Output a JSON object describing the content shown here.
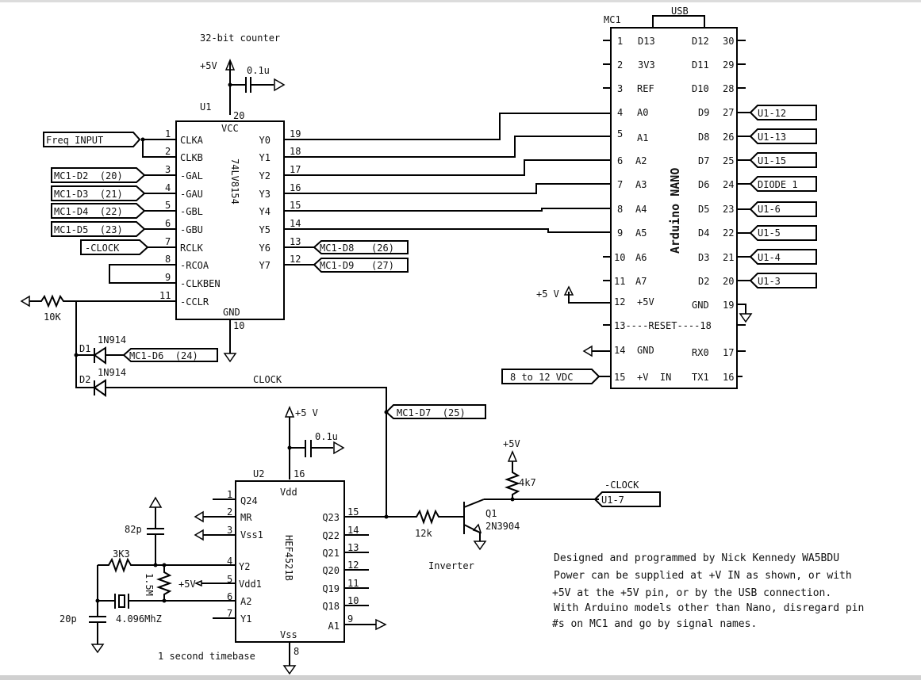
{
  "title": "32-bit counter",
  "u1": {
    "ref": "U1",
    "part": "74LV8154",
    "vcc_label": "VCC",
    "gnd_label": "GND",
    "vcc_pin": "20",
    "gnd_pin": "10",
    "supply": "+5V",
    "cap": "0.1u",
    "left_pins": [
      {
        "num": "1",
        "name": "CLKA"
      },
      {
        "num": "2",
        "name": "CLKB"
      },
      {
        "num": "3",
        "name": "-GAL"
      },
      {
        "num": "4",
        "name": "-GAU"
      },
      {
        "num": "5",
        "name": "-GBL"
      },
      {
        "num": "6",
        "name": "-GBU"
      },
      {
        "num": "7",
        "name": "RCLK"
      },
      {
        "num": "8",
        "name": "-RCOA"
      },
      {
        "num": "9",
        "name": "-CLKBEN"
      },
      {
        "num": "11",
        "name": "-CCLR"
      }
    ],
    "right_pins": [
      {
        "num": "19",
        "name": "Y0"
      },
      {
        "num": "18",
        "name": "Y1"
      },
      {
        "num": "17",
        "name": "Y2"
      },
      {
        "num": "16",
        "name": "Y3"
      },
      {
        "num": "15",
        "name": "Y4"
      },
      {
        "num": "14",
        "name": "Y5"
      },
      {
        "num": "13",
        "name": "Y6"
      },
      {
        "num": "12",
        "name": "Y7"
      }
    ]
  },
  "u1_net_labels": {
    "freq_input": "Freq INPUT",
    "gal": "MC1-D2  (20)",
    "gau": "MC1-D3  (21)",
    "gbl": "MC1-D4  (22)",
    "gbu": "MC1-D5  (23)",
    "rclk": "-CLOCK",
    "y6": "MC1-D8   (26)",
    "y7": "MC1-D9   (27)"
  },
  "reset_network": {
    "resistor": "10K",
    "d1_ref": "D1",
    "d1_part": "1N914",
    "d1_net": "MC1-D6  (24)",
    "d2_ref": "D2",
    "d2_part": "1N914",
    "clock_label": "CLOCK",
    "d7_net": "MC1-D7  (25)"
  },
  "mc1": {
    "ref": "MC1",
    "name": "Arduino NANO",
    "usb": "USB",
    "left_pins": [
      {
        "num": "1",
        "name": "D13"
      },
      {
        "num": "2",
        "name": "3V3"
      },
      {
        "num": "3",
        "name": "REF"
      },
      {
        "num": "4",
        "name": "A0"
      },
      {
        "num": "5",
        "name": "A1"
      },
      {
        "num": "6",
        "name": "A2"
      },
      {
        "num": "7",
        "name": "A3"
      },
      {
        "num": "8",
        "name": "A4"
      },
      {
        "num": "9",
        "name": "A5"
      },
      {
        "num": "10",
        "name": "A6"
      },
      {
        "num": "11",
        "name": "A7"
      },
      {
        "num": "12",
        "name": "+5V"
      },
      {
        "num": "14",
        "name": "GND"
      },
      {
        "num": "15",
        "name": "+V  IN"
      }
    ],
    "right_pins": [
      {
        "num": "30",
        "name": "D12"
      },
      {
        "num": "29",
        "name": "D11"
      },
      {
        "num": "28",
        "name": "D10"
      },
      {
        "num": "27",
        "name": "D9"
      },
      {
        "num": "26",
        "name": "D8"
      },
      {
        "num": "25",
        "name": "D7"
      },
      {
        "num": "24",
        "name": "D6"
      },
      {
        "num": "23",
        "name": "D5"
      },
      {
        "num": "22",
        "name": "D4"
      },
      {
        "num": "21",
        "name": "D3"
      },
      {
        "num": "20",
        "name": "D2"
      },
      {
        "num": "19",
        "name": "GND"
      },
      {
        "num": "17",
        "name": "RX0"
      },
      {
        "num": "16",
        "name": "TX1"
      }
    ],
    "reset_row": "13----RESET----18",
    "net_labels": [
      "U1-12",
      "U1-13",
      "U1-15",
      "DIODE 1",
      "U1-6",
      "U1-5",
      "U1-4",
      "U1-3"
    ],
    "plus5_label": "+5 V",
    "vin_label": "8 to 12 VDC"
  },
  "u2": {
    "ref": "U2",
    "part": "HEF4521B",
    "vdd_label": "Vdd",
    "vss_label": "Vss",
    "vdd_pin": "16",
    "vss_pin": "8",
    "supply": "+5 V",
    "cap": "0.1u",
    "left_pins": [
      {
        "num": "1",
        "name": "Q24"
      },
      {
        "num": "2",
        "name": "MR"
      },
      {
        "num": "3",
        "name": "Vss1"
      },
      {
        "num": "4",
        "name": "Y2"
      },
      {
        "num": "5",
        "name": "Vdd1"
      },
      {
        "num": "6",
        "name": "A2"
      },
      {
        "num": "7",
        "name": "Y1"
      }
    ],
    "right_pins": [
      {
        "num": "15",
        "name": "Q23"
      },
      {
        "num": "14",
        "name": "Q22"
      },
      {
        "num": "13",
        "name": "Q21"
      },
      {
        "num": "12",
        "name": "Q20"
      },
      {
        "num": "11",
        "name": "Q19"
      },
      {
        "num": "10",
        "name": "Q18"
      },
      {
        "num": "9",
        "name": "A1"
      }
    ],
    "caption": "1 second timebase"
  },
  "oscillator": {
    "c1": "82p",
    "r1": "3K3",
    "r2": "1.5M",
    "vdd1": "+5V",
    "xtal": "4.096MhZ",
    "c2": "20p"
  },
  "inverter": {
    "r_base": "12k",
    "r_pull": "4k7",
    "supply": "+5V",
    "q_ref": "Q1",
    "q_part": "2N3904",
    "caption": "Inverter",
    "out_label": "-CLOCK",
    "out_net": "U1-7"
  },
  "notes": [
    "Designed and programmed by Nick Kennedy WA5BDU",
    "Power can be supplied at +V IN as shown, or with",
    "+5V at the +5V pin, or by the USB connection.",
    "With Arduino models other than Nano, disregard pin",
    "#s on MC1 and go by signal names."
  ]
}
